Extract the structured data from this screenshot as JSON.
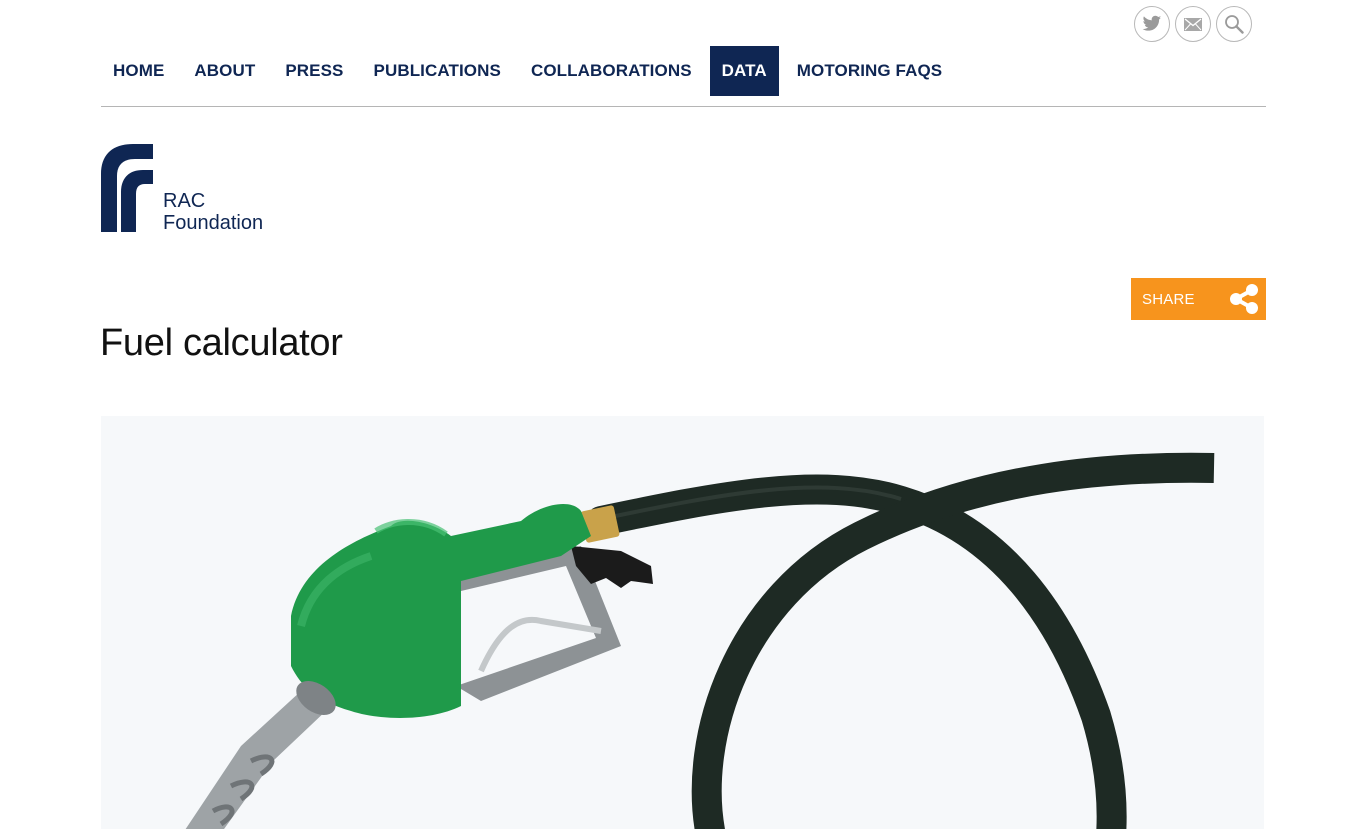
{
  "social": [
    {
      "name": "twitter-icon"
    },
    {
      "name": "email-icon"
    },
    {
      "name": "search-icon"
    }
  ],
  "nav": {
    "items": [
      {
        "label": "HOME",
        "active": false
      },
      {
        "label": "ABOUT",
        "active": false
      },
      {
        "label": "PRESS",
        "active": false
      },
      {
        "label": "PUBLICATIONS",
        "active": false
      },
      {
        "label": "COLLABORATIONS",
        "active": false
      },
      {
        "label": "DATA",
        "active": true
      },
      {
        "label": "MOTORING FAQS",
        "active": false
      }
    ]
  },
  "logo": {
    "line1": "RAC",
    "line2": "Foundation",
    "icon": "rac-foundation-logo"
  },
  "share": {
    "label": "SHARE",
    "icon": "share-icon"
  },
  "page": {
    "title": "Fuel calculator"
  },
  "hero": {
    "icon": "fuel-pump-nozzle-image"
  },
  "colors": {
    "brand_navy": "#0f2653",
    "share_orange": "#f7941d",
    "nozzle_green": "#1f9a4a",
    "hose_dark": "#1e2a24"
  }
}
